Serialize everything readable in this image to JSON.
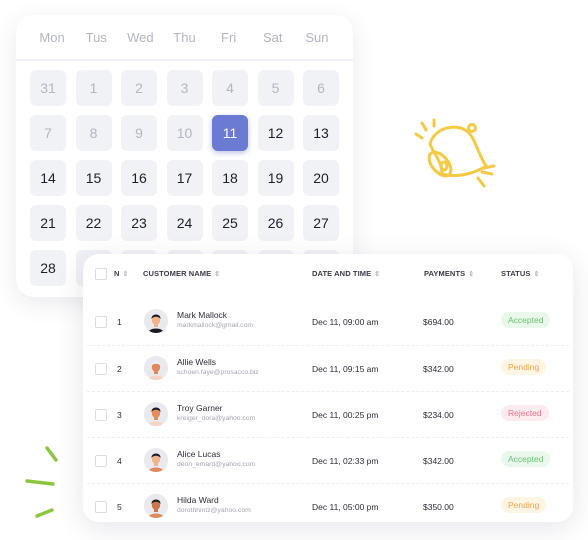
{
  "calendar": {
    "weekdays": [
      "Mon",
      "Tus",
      "Wed",
      "Thu",
      "Fri",
      "Sat",
      "Sun"
    ],
    "selected_day": "11",
    "selected_color": "#6b7bd4",
    "days": [
      {
        "label": "31",
        "muted": true
      },
      {
        "label": "1",
        "muted": true
      },
      {
        "label": "2",
        "muted": true
      },
      {
        "label": "3",
        "muted": true
      },
      {
        "label": "4",
        "muted": true
      },
      {
        "label": "5",
        "muted": true
      },
      {
        "label": "6",
        "muted": true
      },
      {
        "label": "7",
        "muted": true
      },
      {
        "label": "8",
        "muted": true
      },
      {
        "label": "9",
        "muted": true
      },
      {
        "label": "10",
        "muted": true
      },
      {
        "label": "11",
        "selected": true
      },
      {
        "label": "12"
      },
      {
        "label": "13"
      },
      {
        "label": "14"
      },
      {
        "label": "15"
      },
      {
        "label": "16"
      },
      {
        "label": "17"
      },
      {
        "label": "18"
      },
      {
        "label": "19"
      },
      {
        "label": "20"
      },
      {
        "label": "21"
      },
      {
        "label": "22"
      },
      {
        "label": "23"
      },
      {
        "label": "24"
      },
      {
        "label": "25"
      },
      {
        "label": "26"
      },
      {
        "label": "27"
      },
      {
        "label": "28"
      },
      {
        "label": ""
      },
      {
        "label": ""
      },
      {
        "label": ""
      },
      {
        "label": ""
      },
      {
        "label": ""
      },
      {
        "label": ""
      }
    ]
  },
  "decorations": {
    "bell_icon": "bell-icon",
    "bell_color": "#f6c944",
    "sparks_color": "#8cc63f"
  },
  "table": {
    "headers": {
      "n": "N",
      "customer": "CUSTOMER NAME",
      "date": "DATE AND TIME",
      "payments": "PAYMENTS",
      "status": "STATUS"
    },
    "rows": [
      {
        "n": "1",
        "name": "Mark Mallock",
        "email": "markmallock@gmail.com",
        "date": "Dec 11, 09:00 am",
        "payment": "$694.00",
        "status": "Accepted",
        "status_type": "accepted"
      },
      {
        "n": "2",
        "name": "Allie Wells",
        "email": "schoen.faye@prosacco.biz",
        "date": "Dec 11, 09:15 am",
        "payment": "$342.00",
        "status": "Pending",
        "status_type": "pending"
      },
      {
        "n": "3",
        "name": "Troy Garner",
        "email": "kreiger_dora@yahoo.com",
        "date": "Dec 11, 00:25 pm",
        "payment": "$234.00",
        "status": "Rejected",
        "status_type": "rejected"
      },
      {
        "n": "4",
        "name": "Alice Lucas",
        "email": "deon_emard@yahoo.com",
        "date": "Dec 11, 02:33 pm",
        "payment": "$342.00",
        "status": "Accepted",
        "status_type": "accepted"
      },
      {
        "n": "5",
        "name": "Hilda Ward",
        "email": "dorothhintz@yahoo.com",
        "date": "Dec 11, 05:00 pm",
        "payment": "$350.00",
        "status": "Pending",
        "status_type": "pending"
      }
    ],
    "status_colors": {
      "accepted": {
        "text": "#6cc070",
        "bg": "#eaf8ec"
      },
      "pending": {
        "text": "#f0a447",
        "bg": "#fff5e3"
      },
      "rejected": {
        "text": "#ef6f8a",
        "bg": "#fdecef"
      }
    }
  }
}
